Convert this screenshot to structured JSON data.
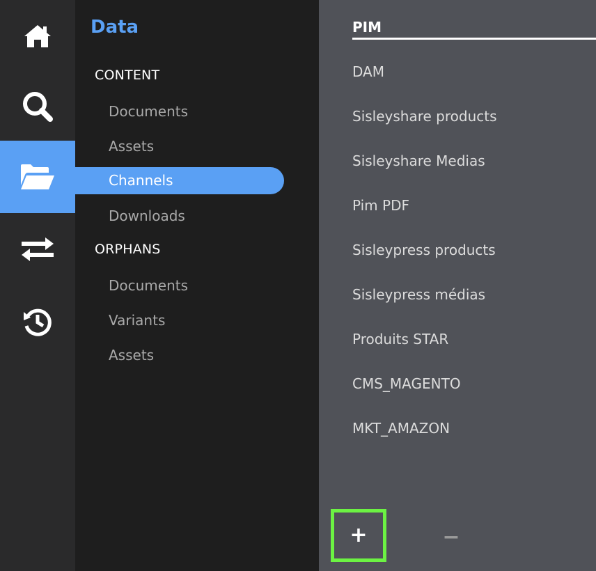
{
  "rail": {
    "items": [
      {
        "icon": "home-icon"
      },
      {
        "icon": "search-icon"
      },
      {
        "icon": "folder-open-icon",
        "active": true
      },
      {
        "icon": "transfer-icon"
      },
      {
        "icon": "history-icon"
      }
    ],
    "accent": "#5aa0f4"
  },
  "tree": {
    "title": "Data",
    "content_section": "CONTENT",
    "content_items": [
      "Documents",
      "Assets",
      "Channels",
      "Downloads"
    ],
    "active_item": "Channels",
    "orphans_section": "ORPHANS",
    "orphans_items": [
      "Documents",
      "Variants",
      "Assets"
    ]
  },
  "channels": {
    "selected": "PIM",
    "items": [
      "PIM",
      "DAM",
      "Sisleyshare products",
      "Sisleyshare Medias",
      "Pim PDF",
      "Sisleypress products",
      "Sisleypress médias",
      "Produits STAR",
      "CMS_MAGENTO",
      "MKT_AMAZON"
    ],
    "add_label": "+",
    "remove_label": "−",
    "highlight_color": "#6cf343"
  }
}
